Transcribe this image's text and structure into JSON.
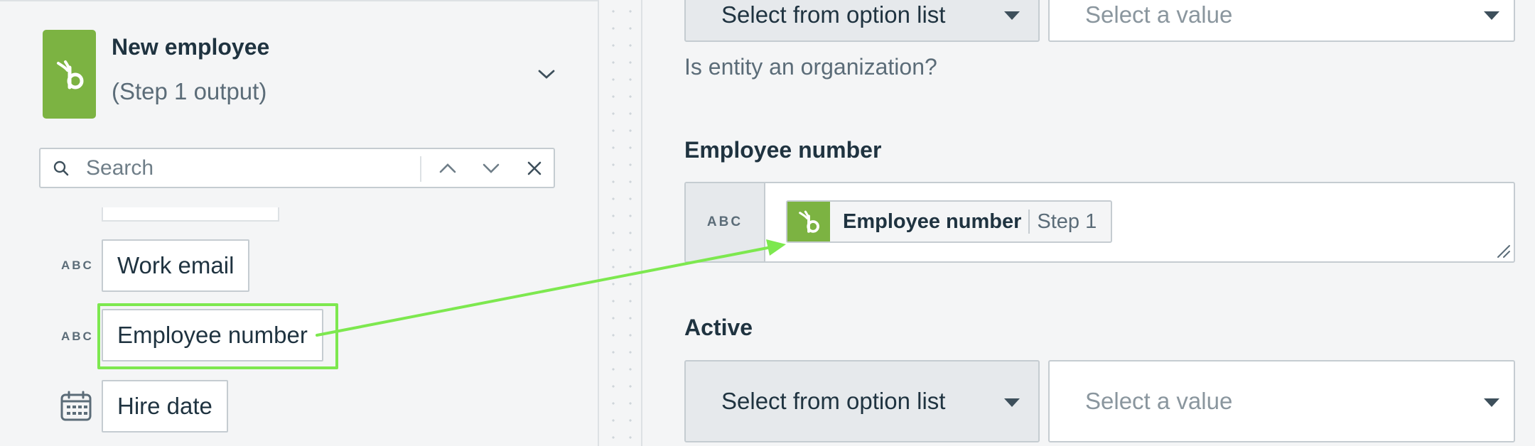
{
  "step": {
    "title": "New employee",
    "subtitle": "(Step 1 output)",
    "logo_icon": "bamboohr-logo-icon",
    "brand_color": "#7cb342"
  },
  "search": {
    "placeholder": "Search"
  },
  "datapills": [
    {
      "type": "ABC",
      "label": "Work email"
    },
    {
      "type": "ABC",
      "label": "Employee number"
    },
    {
      "type": "calendar-icon",
      "label": "Hire date"
    }
  ],
  "right": {
    "top_dropdown": {
      "mode": "Select from option list",
      "value_placeholder": "Select a value"
    },
    "hint": "Is entity an organization?",
    "employee_number": {
      "label": "Employee number",
      "type": "ABC",
      "mapped_pill": {
        "name": "Employee number",
        "step": "Step 1"
      }
    },
    "active": {
      "label": "Active",
      "mode": "Select from option list",
      "value_placeholder": "Select a value"
    }
  },
  "colors": {
    "highlight": "#7de84f",
    "text": "#1f3340",
    "muted": "#5b6c78"
  }
}
